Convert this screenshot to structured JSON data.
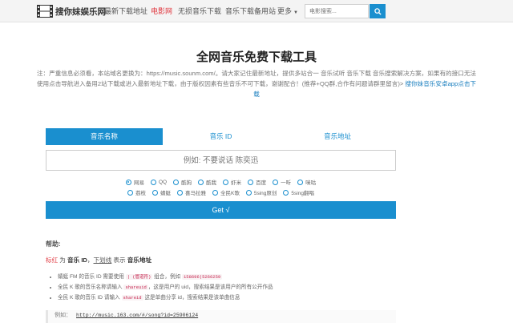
{
  "header": {
    "logo_text": "搜你妹娱乐网",
    "nav": [
      {
        "label": "最新下载地址"
      },
      {
        "label": "电影网"
      },
      {
        "label": "无损音乐下载"
      },
      {
        "label": "音乐下载备用站"
      },
      {
        "label": "更多"
      }
    ],
    "search_placeholder": "电影搜索...",
    "accent_color": "#1a8fcf",
    "active_nav_color": "#e0353d"
  },
  "main": {
    "title": "全网音乐免费下载工具",
    "notice_text": "注：严重信息必须看，本站域名更换为：https://music.sounm.com/。请大家记住最新地址，提供多站合一 音乐试听 音乐下载 音乐搜索解决方案，如果有的接口无法使用点击导航进入备用2站下载或进入最新地址下载，由于版权因素有些音乐不可下载，谢谢配合！(推荐+QQ群,合作有问题请群里留言)>",
    "notice_link": "搜你妹音乐安卓app点击下载",
    "tabs": [
      {
        "label": "音乐名称",
        "active": true
      },
      {
        "label": "音乐 ID",
        "active": false
      },
      {
        "label": "音乐地址",
        "active": false
      }
    ],
    "input_placeholder": "例如: 不要说话 陈奕迅",
    "sources_row1": [
      {
        "label": "网易",
        "checked": true
      },
      {
        "label": "QQ",
        "checked": false
      },
      {
        "label": "酷狗",
        "checked": false
      },
      {
        "label": "酷我",
        "checked": false
      },
      {
        "label": "虾米",
        "checked": false
      },
      {
        "label": "百度",
        "checked": false
      },
      {
        "label": "一听",
        "checked": false
      },
      {
        "label": "咪咕",
        "checked": false
      }
    ],
    "sources_row2": [
      {
        "label": "荔枝",
        "checked": false
      },
      {
        "label": "蜻蜓",
        "checked": false
      },
      {
        "label": "喜马拉雅",
        "checked": false
      },
      {
        "label": "全民K歌",
        "checked": false
      },
      {
        "label": "5sing原创",
        "checked": false
      },
      {
        "label": "5sing翻唱",
        "checked": false
      }
    ],
    "get_button": "Get √"
  },
  "help": {
    "title": "帮助:",
    "line_red": "标红",
    "line_text1": " 为 ",
    "line_bold1": "音乐 ID",
    "line_text2": "，",
    "line_underline": "下划线",
    "line_text3": " 表示 ",
    "line_bold2": "音乐地址",
    "items": [
      {
        "pre": "蜻蜓 FM 的音乐 ID 需要使用 ",
        "code1": "| (管道符)",
        "mid": " 组合，例如 ",
        "code2": "158696|5266259",
        "post": ""
      },
      {
        "pre": "全民 K 歌的音乐名称请输入 ",
        "code1": "shareuid",
        "mid": "，这是用户的 uid，搜索结果是该用户的所有公开作品",
        "code2": "",
        "post": ""
      },
      {
        "pre": "全民 K 歌的音乐 ID 请输入 ",
        "code1": "shareid",
        "mid": " 这是单曲分享 id，搜索结果是该单曲信息",
        "code2": "",
        "post": ""
      }
    ],
    "example_label": "例如：",
    "example_url": "http://music.163.com/#/song?id=25906124"
  }
}
